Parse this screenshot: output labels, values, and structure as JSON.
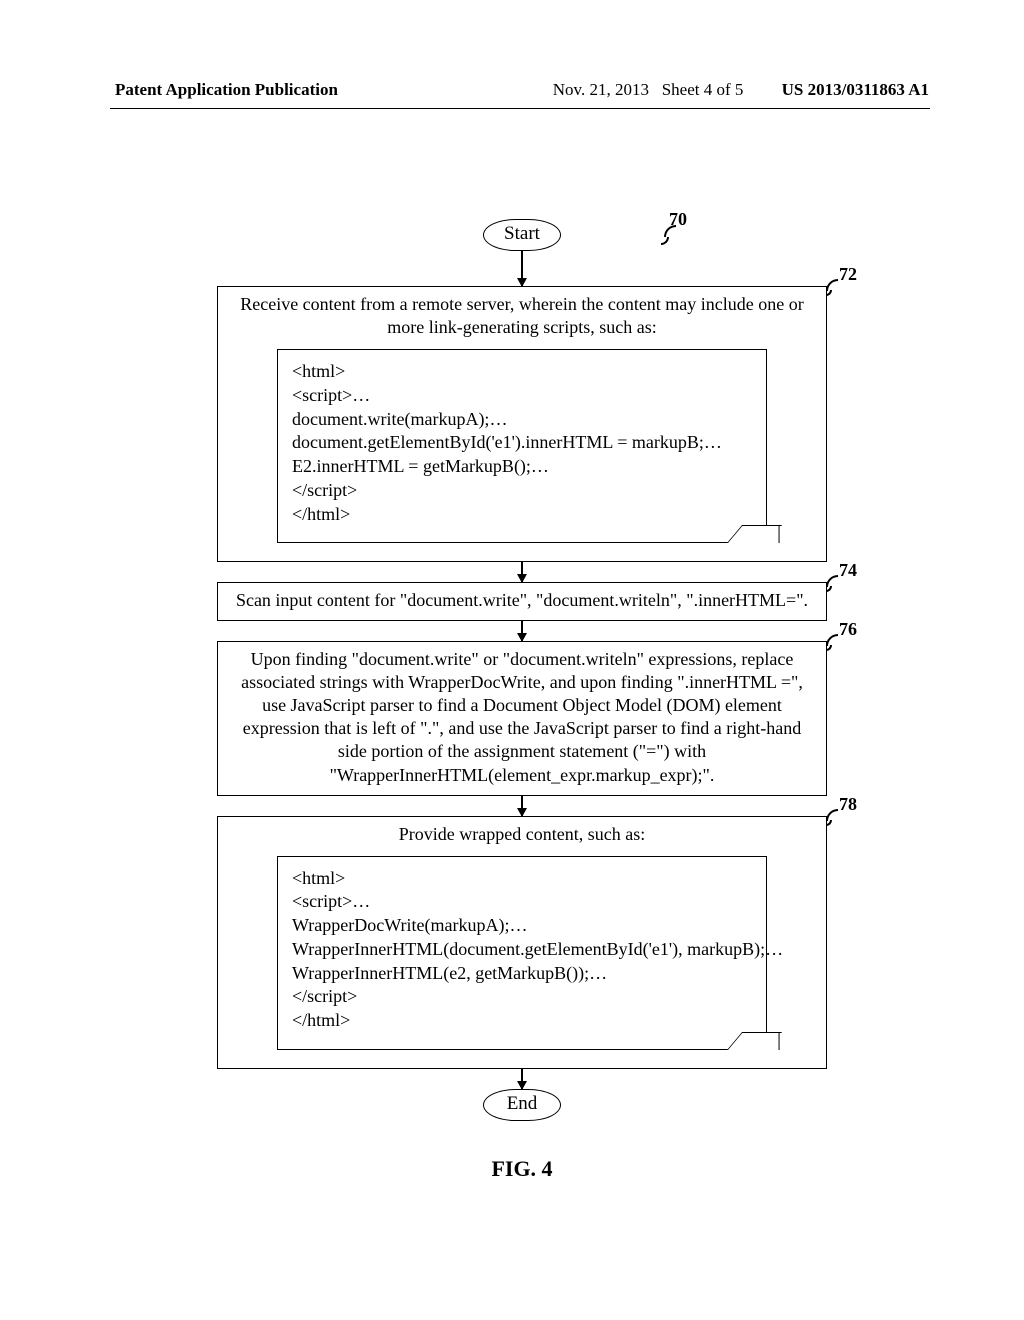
{
  "header": {
    "left": "Patent Application Publication",
    "date": "Nov. 21, 2013",
    "sheet": "Sheet 4 of 5",
    "pubno": "US 2013/0311863 A1"
  },
  "refs": {
    "main": "70",
    "r72": "72",
    "r74": "74",
    "r76": "76",
    "r78": "78"
  },
  "terminals": {
    "start": "Start",
    "end": "End"
  },
  "steps": {
    "s72": {
      "text": "Receive content from a remote server, wherein the content may include one or more link-generating scripts, such as:",
      "code": [
        "<html>",
        "<script>…",
        "document.write(markupA);…",
        "document.getElementById('e1').innerHTML = markupB;…",
        "E2.innerHTML = getMarkupB();…",
        "</script>",
        "</html>"
      ]
    },
    "s74": {
      "text": "Scan input content for \"document.write\", \"document.writeln\", \".innerHTML=\"."
    },
    "s76": {
      "text": "Upon finding \"document.write\" or \"document.writeln\" expressions, replace associated strings with WrapperDocWrite, and upon finding \".innerHTML =\",  use JavaScript parser to find a Document Object Model (DOM) element expression that is left of \".\", and use the JavaScript parser to find a right-hand side portion of the assignment statement (\"=\") with \"WrapperInnerHTML(element_expr.markup_expr);\"."
    },
    "s78": {
      "text": "Provide wrapped content, such as:",
      "code": [
        "<html>",
        "<script>…",
        "WrapperDocWrite(markupA);…",
        "WrapperInnerHTML(document.getElementById('e1'), markupB);…",
        "WrapperInnerHTML(e2, getMarkupB());…",
        "</script>",
        "</html>"
      ]
    }
  },
  "figure": "FIG. 4"
}
